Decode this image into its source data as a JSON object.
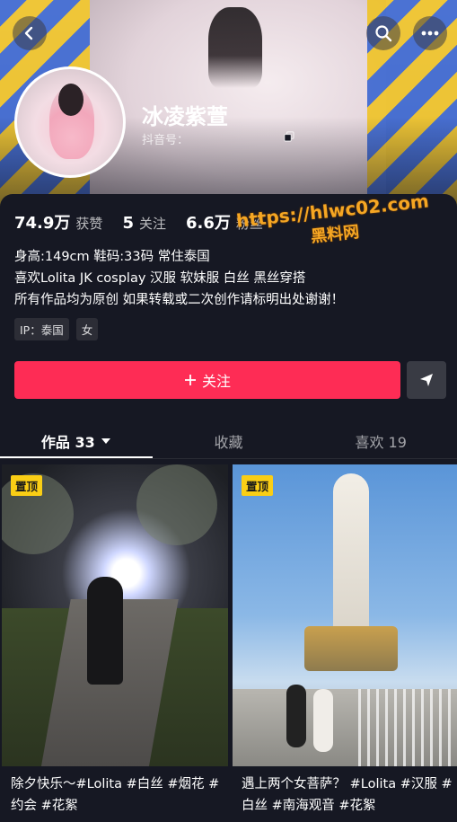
{
  "profile": {
    "nickname": "冰凌紫萱",
    "douyin_id_label": "抖音号：",
    "stats": [
      {
        "value": "74.9万",
        "label": "获赞"
      },
      {
        "value": "5",
        "label": "关注"
      },
      {
        "value": "6.6万",
        "label": "粉丝"
      }
    ],
    "bio": [
      "身高:149cm 鞋码:33码 常住泰国",
      "喜欢Lolita JK cosplay 汉服 软妹服 白丝 黑丝穿搭",
      "所有作品均为原创  如果转载或二次创作请标明出处谢谢！"
    ],
    "tags": [
      "IP：泰国",
      "女"
    ]
  },
  "watermark": {
    "line1": "https://hlwc02.com",
    "line2": "黑料网"
  },
  "actions": {
    "follow_label": "关注"
  },
  "tabs": [
    {
      "label": "作品 33",
      "active": true
    },
    {
      "label": "收藏",
      "active": false
    },
    {
      "label": "喜欢 19",
      "active": false
    }
  ],
  "videos": [
    {
      "pin_label": "置顶",
      "caption": "除夕快乐～#Lolita #白丝 #烟花 #约会 #花絮"
    },
    {
      "pin_label": "置顶",
      "caption": "遇上两个女菩萨？ #Lolita #汉服 #白丝 #南海观音 #花絮"
    }
  ],
  "colors": {
    "accent": "#fe2c55",
    "pin": "#face15",
    "background": "#161823",
    "watermark": "#f5a623"
  },
  "icons": [
    "back-icon",
    "search-icon",
    "more-icon",
    "copy-icon",
    "plus-icon",
    "share-icon",
    "chevron-down-icon"
  ]
}
